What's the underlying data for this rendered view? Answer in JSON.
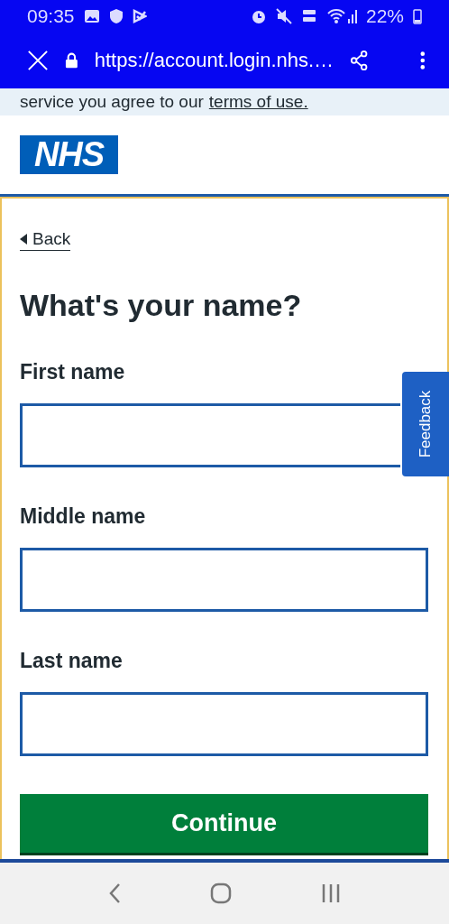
{
  "status_bar": {
    "time": "09:35",
    "battery": "22%"
  },
  "browser": {
    "url": "https://account.login.nhs.…"
  },
  "banner": {
    "text": "service you agree to our",
    "link": "terms of use."
  },
  "header": {
    "logo_text": "NHS"
  },
  "back_link": "Back",
  "heading": "What's your name?",
  "fields": [
    {
      "label": "First name"
    },
    {
      "label": "Middle name"
    },
    {
      "label": "Last name"
    }
  ],
  "continue_button": "Continue",
  "feedback_tab": "Feedback"
}
